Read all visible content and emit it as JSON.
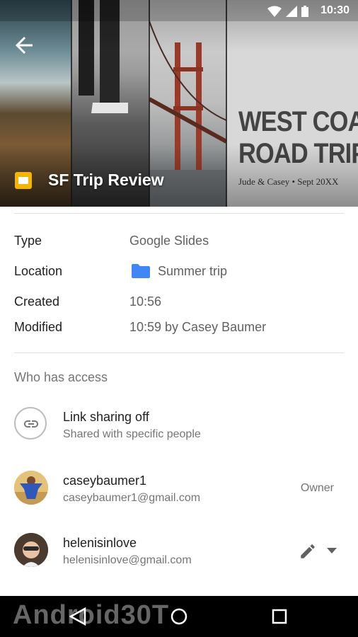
{
  "status": {
    "time": "10:30"
  },
  "header": {
    "poster_line1": "WEST COAST",
    "poster_line2": "ROAD TRIP",
    "poster_sub": "Jude & Casey • Sept 20XX",
    "doc_title": "SF Trip Review",
    "back_icon": "arrow-back-icon",
    "doc_icon": "google-slides-icon"
  },
  "details": {
    "type_label": "Type",
    "type_value": "Google Slides",
    "location_label": "Location",
    "location_value": "Summer trip",
    "created_label": "Created",
    "created_value": "10:56",
    "modified_label": "Modified",
    "modified_value": "10:59 by Casey Baumer"
  },
  "access": {
    "heading": "Who has access",
    "link": {
      "title": "Link sharing off",
      "subtitle": "Shared with specific people",
      "icon": "link-icon"
    },
    "people": [
      {
        "name": "caseybaumer1",
        "email": "caseybaumer1@gmail.com",
        "role": "Owner"
      },
      {
        "name": "helenisinlove",
        "email": "helenisinlove@gmail.com",
        "role": ""
      }
    ]
  },
  "navbar": {
    "watermark": "Android30T"
  },
  "colors": {
    "accent_blue": "#4285f4",
    "slides_yellow": "#f4b400"
  }
}
